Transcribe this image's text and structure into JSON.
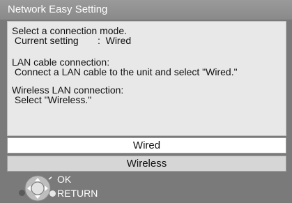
{
  "window": {
    "title": "Network Easy Setting"
  },
  "content": {
    "line1": "Select a connection mode.",
    "line2": " Current setting       :  Wired",
    "line3": "LAN cable connection:",
    "line4": " Connect a LAN cable to the unit and select \"Wired.\"",
    "line5": "Wireless LAN connection:",
    "line6": " Select \"Wireless.\""
  },
  "options": [
    {
      "label": "Wired",
      "selected": true
    },
    {
      "label": "Wireless",
      "selected": false
    }
  ],
  "hints": {
    "ok": "OK",
    "return": "RETURN"
  },
  "colors": {
    "background": "#7a7a7a",
    "panel": "#e8e8e8",
    "selected": "#ffffff",
    "unselected": "#d6d6d6"
  },
  "icons": {
    "remote": "remote-cursor-pad-icon"
  }
}
